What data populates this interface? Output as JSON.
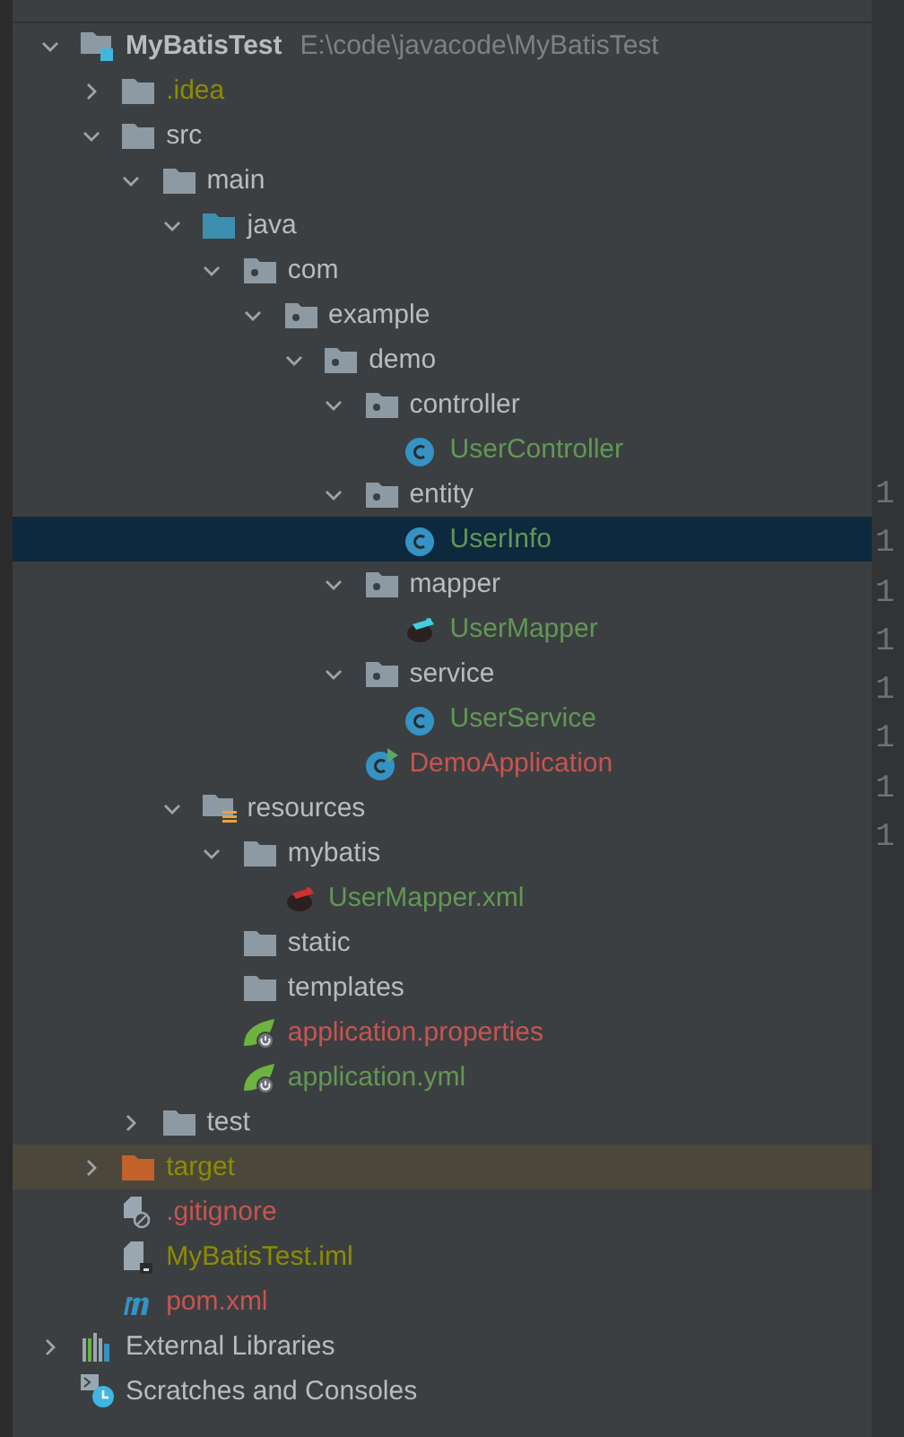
{
  "tree": [
    {
      "label": "MyBatisTest",
      "path": "E:\\code\\javacode\\MyBatisTest",
      "kind": "module",
      "expanded": true,
      "selected": false,
      "children": [
        {
          "label": ".idea",
          "kind": "folder",
          "color": "#8c8c00",
          "expanded": false,
          "selected": false
        },
        {
          "label": "src",
          "kind": "folder",
          "expanded": true,
          "selected": false,
          "children": [
            {
              "label": "main",
              "kind": "folder",
              "expanded": true,
              "selected": false,
              "children": [
                {
                  "label": "java",
                  "kind": "source-folder",
                  "expanded": true,
                  "selected": false,
                  "children": [
                    {
                      "label": "com",
                      "kind": "package",
                      "expanded": true,
                      "selected": false,
                      "children": [
                        {
                          "label": "example",
                          "kind": "package",
                          "expanded": true,
                          "selected": false,
                          "children": [
                            {
                              "label": "demo",
                              "kind": "package",
                              "expanded": true,
                              "selected": false,
                              "children": [
                                {
                                  "label": "controller",
                                  "kind": "package",
                                  "expanded": true,
                                  "selected": false,
                                  "children": [
                                    {
                                      "label": "UserController",
                                      "kind": "class",
                                      "color": "#629755",
                                      "selected": false
                                    }
                                  ]
                                },
                                {
                                  "label": "entity",
                                  "kind": "package",
                                  "expanded": true,
                                  "selected": false,
                                  "children": [
                                    {
                                      "label": "UserInfo",
                                      "kind": "class",
                                      "color": "#629755",
                                      "selected": true
                                    }
                                  ]
                                },
                                {
                                  "label": "mapper",
                                  "kind": "package",
                                  "expanded": true,
                                  "selected": false,
                                  "children": [
                                    {
                                      "label": "UserMapper",
                                      "kind": "mybatis",
                                      "color": "#629755",
                                      "selected": false
                                    }
                                  ]
                                },
                                {
                                  "label": "service",
                                  "kind": "package",
                                  "expanded": true,
                                  "selected": false,
                                  "children": [
                                    {
                                      "label": "UserService",
                                      "kind": "class",
                                      "color": "#629755",
                                      "selected": false
                                    }
                                  ]
                                },
                                {
                                  "label": "DemoApplication",
                                  "kind": "app-class",
                                  "color": "#c75450",
                                  "selected": false
                                }
                              ]
                            }
                          ]
                        }
                      ]
                    }
                  ]
                },
                {
                  "label": "resources",
                  "kind": "resources",
                  "expanded": true,
                  "selected": false,
                  "children": [
                    {
                      "label": "mybatis",
                      "kind": "folder",
                      "expanded": true,
                      "selected": false,
                      "children": [
                        {
                          "label": "UserMapper.xml",
                          "kind": "mybatis-xml",
                          "color": "#629755",
                          "selected": false
                        }
                      ]
                    },
                    {
                      "label": "static",
                      "kind": "folder",
                      "selected": false
                    },
                    {
                      "label": "templates",
                      "kind": "folder",
                      "selected": false
                    },
                    {
                      "label": "application.properties",
                      "kind": "spring-config",
                      "color": "#c75450",
                      "selected": false
                    },
                    {
                      "label": "application.yml",
                      "kind": "spring-config",
                      "color": "#629755",
                      "selected": false
                    }
                  ]
                }
              ]
            },
            {
              "label": "test",
              "kind": "folder",
              "expanded": false,
              "selected": false
            }
          ]
        },
        {
          "label": "target",
          "kind": "excluded-folder",
          "color": "#8c8c00",
          "expanded": false,
          "selected": false
        },
        {
          "label": ".gitignore",
          "kind": "ignore-file",
          "color": "#c75450",
          "selected": false
        },
        {
          "label": "MyBatisTest.iml",
          "kind": "module-file",
          "color": "#8c8c00",
          "selected": false
        },
        {
          "label": "pom.xml",
          "kind": "maven",
          "color": "#c75450",
          "selected": false
        }
      ]
    },
    {
      "label": "External Libraries",
      "kind": "libraries",
      "expanded": false,
      "selected": false
    },
    {
      "label": "Scratches and Consoles",
      "kind": "scratches",
      "selected": false
    }
  ],
  "gutter": [
    "1",
    "1",
    "1",
    "1",
    "1",
    "1",
    "1",
    "1"
  ]
}
